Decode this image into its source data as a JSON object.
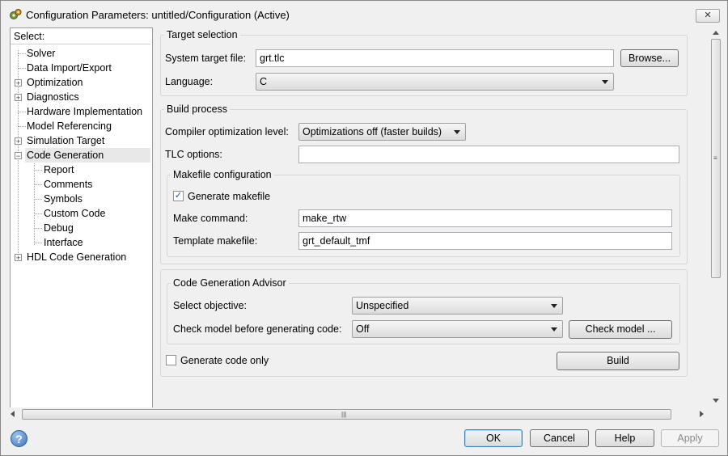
{
  "window": {
    "title": "Configuration Parameters: untitled/Configuration (Active)",
    "close_glyph": "✕"
  },
  "tree": {
    "header": "Select:",
    "items": [
      {
        "label": "Solver"
      },
      {
        "label": "Data Import/Export"
      },
      {
        "label": "Optimization"
      },
      {
        "label": "Diagnostics"
      },
      {
        "label": "Hardware Implementation"
      },
      {
        "label": "Model Referencing"
      },
      {
        "label": "Simulation Target"
      },
      {
        "label": "Code Generation"
      },
      {
        "label": "Report"
      },
      {
        "label": "Comments"
      },
      {
        "label": "Symbols"
      },
      {
        "label": "Custom Code"
      },
      {
        "label": "Debug"
      },
      {
        "label": "Interface"
      },
      {
        "label": "HDL Code Generation"
      }
    ],
    "selected": "Code Generation"
  },
  "target_selection": {
    "title": "Target selection",
    "system_target_label": "System target file:",
    "system_target_value": "grt.tlc",
    "browse_label": "Browse...",
    "language_label": "Language:",
    "language_value": "C"
  },
  "build_process": {
    "title": "Build process",
    "compiler_opt_label": "Compiler optimization level:",
    "compiler_opt_value": "Optimizations off (faster builds)",
    "tlc_label": "TLC options:",
    "tlc_value": "",
    "makefile": {
      "title": "Makefile configuration",
      "generate_label": "Generate makefile",
      "generate_checked": true,
      "make_command_label": "Make command:",
      "make_command_value": "make_rtw",
      "template_label": "Template makefile:",
      "template_value": "grt_default_tmf"
    }
  },
  "advisor": {
    "title": "Code Generation Advisor",
    "objective_label": "Select objective:",
    "objective_value": "Unspecified",
    "check_label": "Check model before generating code:",
    "check_value": "Off",
    "check_button": "Check model ..."
  },
  "generate_code_only_label": "Generate code only",
  "generate_code_only_checked": false,
  "build_button": "Build",
  "footer": {
    "help_glyph": "?",
    "ok": "OK",
    "cancel": "Cancel",
    "help": "Help",
    "apply": "Apply"
  },
  "glyphs": {
    "check": "✓",
    "expand": "+",
    "collapse": "−",
    "grip": "|||",
    "grip_v": "≡"
  }
}
